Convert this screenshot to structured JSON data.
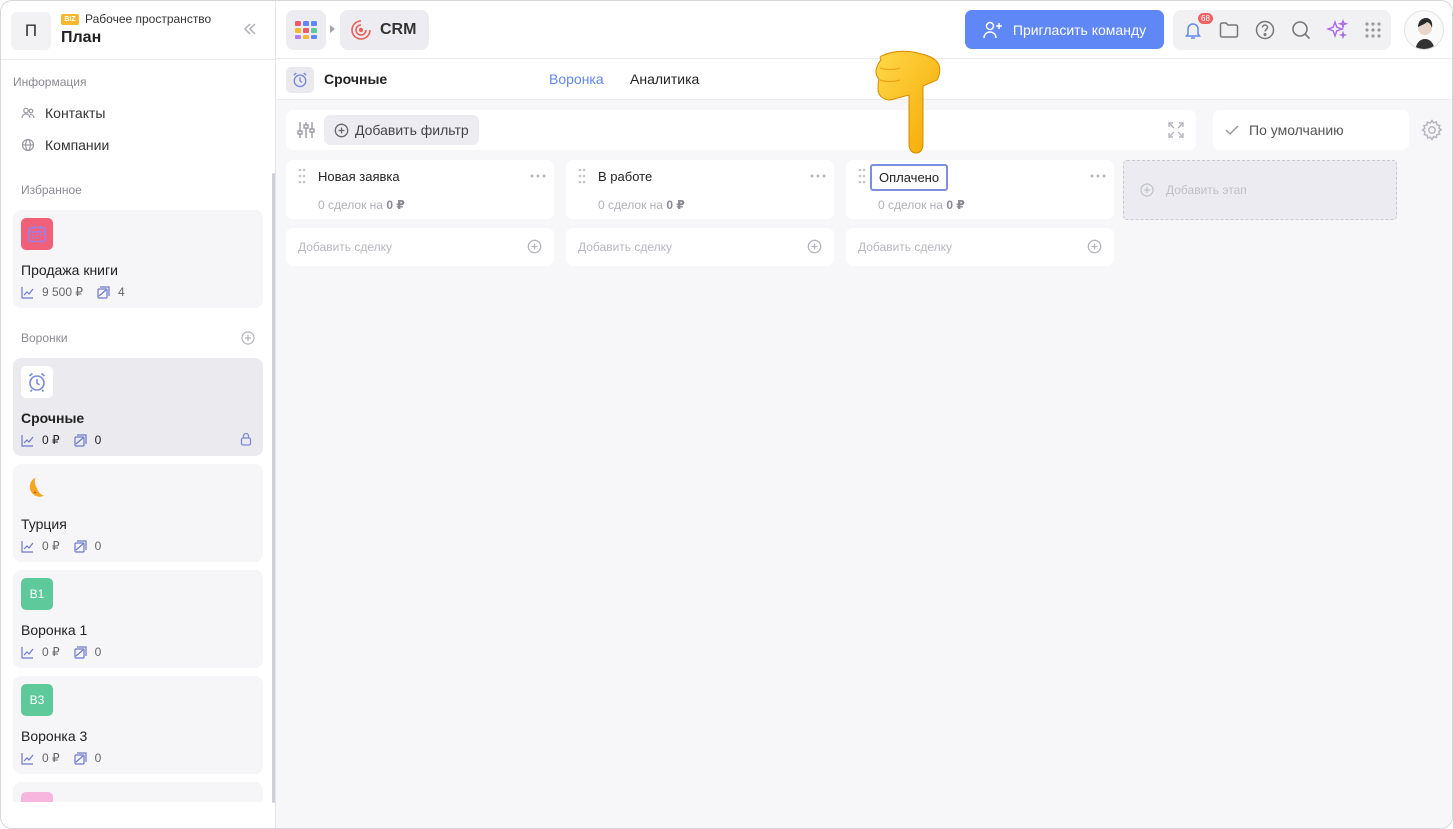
{
  "workspace": {
    "avatar_letter": "П",
    "badge": "BIZ",
    "subtitle": "Рабочее пространство",
    "title": "План"
  },
  "sidebar": {
    "info_label": "Информация",
    "nav": [
      {
        "label": "Контакты",
        "icon": "contacts-icon"
      },
      {
        "label": "Компании",
        "icon": "globe-icon"
      }
    ],
    "favorites_label": "Избранное",
    "favorites": [
      {
        "title": "Продажа книги",
        "sum": "9 500 ₽",
        "count": "4",
        "icon": "calendar-icon",
        "color": "#f0607a"
      }
    ],
    "pipelines_label": "Воронки",
    "pipelines": [
      {
        "title": "Срочные",
        "sum": "0 ₽",
        "count": "0",
        "icon": "alarm-clock-icon",
        "active": true,
        "locked": true
      },
      {
        "title": "Турция",
        "sum": "0 ₽",
        "count": "0",
        "icon": "crescent-moon-icon"
      },
      {
        "title": "Воронка 1",
        "sum": "0 ₽",
        "count": "0",
        "abbr": "В1",
        "color": "#5ec99a"
      },
      {
        "title": "Воронка 3",
        "sum": "0 ₽",
        "count": "0",
        "abbr": "В3",
        "color": "#5ec99a"
      }
    ]
  },
  "topbar": {
    "app_name": "CRM",
    "invite_label": "Пригласить команду",
    "notifications_count": "68",
    "accent": "#5f87f5"
  },
  "subheader": {
    "pipeline_name": "Срочные",
    "tabs": [
      "Воронка",
      "Аналитика"
    ]
  },
  "board": {
    "add_filter_label": "Добавить фильтр",
    "view_label": "По умолчанию",
    "columns": [
      {
        "name": "Новая заявка",
        "count_text": "0 сделок на",
        "sum": "0 ₽",
        "add_label": "Добавить сделку"
      },
      {
        "name": "В работе",
        "count_text": "0 сделок на",
        "sum": "0 ₽",
        "add_label": "Добавить сделку"
      },
      {
        "name": "Оплачено",
        "count_text": "0 сделок на",
        "sum": "0 ₽",
        "add_label": "Добавить сделку",
        "editing": true
      }
    ],
    "add_stage_label": "Добавить этап"
  }
}
